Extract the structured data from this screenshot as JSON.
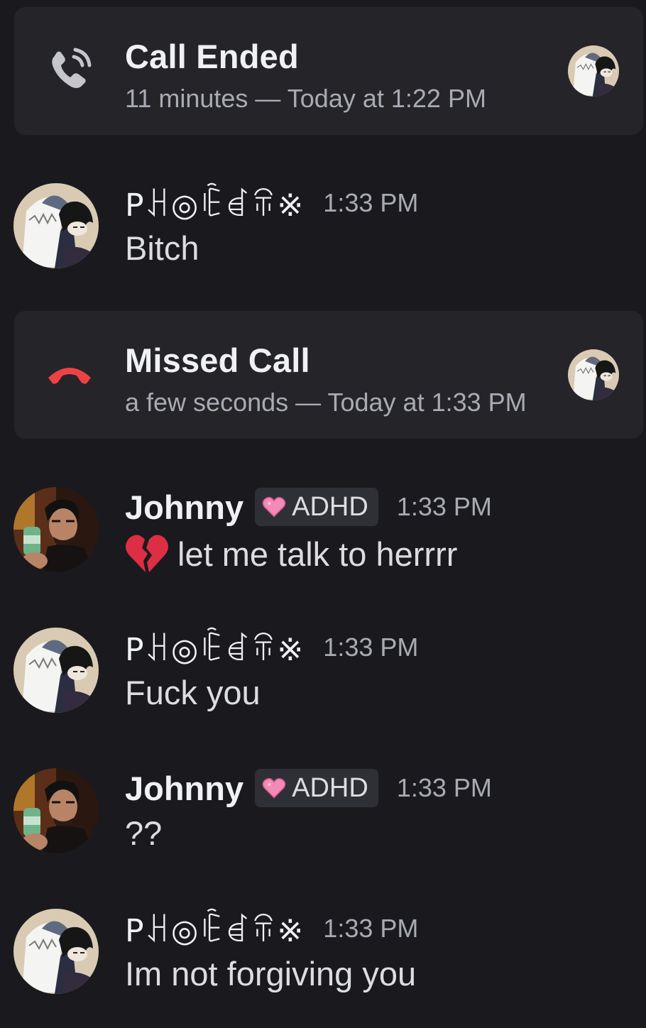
{
  "calls": [
    {
      "title": "Call Ended",
      "subtitle": "11 minutes — Today at 1:22 PM",
      "icon": "phone-ringing-icon",
      "color": "#c4c6cc"
    },
    {
      "title": "Missed Call",
      "subtitle": "a few seconds — Today at 1:33 PM",
      "icon": "phone-hangup-icon",
      "color": "#ed4245"
    }
  ],
  "users": {
    "phoenix": {
      "name": "ꓑꃅ◎ꍟꀸꋖ※"
    },
    "johnny": {
      "name": "Johnny",
      "tag": "ADHD",
      "tag_icon": "pink-heart-icon"
    }
  },
  "messages": [
    {
      "user": "ꓑꃅ◎ꍟꀸꋖ※",
      "time": "1:33 PM",
      "text": "Bitch"
    },
    {
      "user": "Johnny",
      "tag": "ADHD",
      "time": "1:33 PM",
      "emoji": "broken-heart-icon",
      "text": "let me talk to herrrr"
    },
    {
      "user": "ꓑꃅ◎ꍟꀸꋖ※",
      "time": "1:33 PM",
      "text": "Fuck you"
    },
    {
      "user": "Johnny",
      "tag": "ADHD",
      "time": "1:33 PM",
      "text": "??"
    },
    {
      "user": "ꓑꃅ◎ꍟꀸꋖ※",
      "time": "1:33 PM",
      "text": "Im not forgiving you"
    }
  ]
}
